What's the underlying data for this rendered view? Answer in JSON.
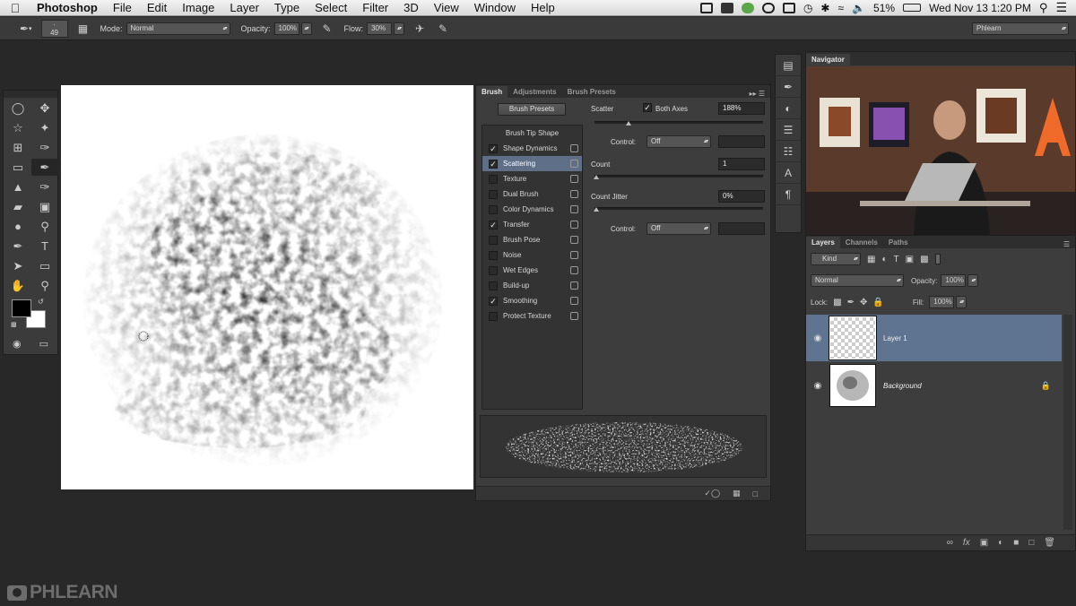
{
  "menubar": {
    "app_name": "Photoshop",
    "items": [
      "File",
      "Edit",
      "Image",
      "Layer",
      "Type",
      "Select",
      "Filter",
      "3D",
      "View",
      "Window",
      "Help"
    ],
    "battery": "51%",
    "datetime": "Wed Nov 13  1:20 PM"
  },
  "options": {
    "brush_size": "49",
    "mode_label": "Mode:",
    "mode_value": "Normal",
    "opacity_label": "Opacity:",
    "opacity_value": "100%",
    "flow_label": "Flow:",
    "flow_value": "30%",
    "workspace": "Phlearn"
  },
  "brush_panel": {
    "tabs": [
      "Brush",
      "Adjustments",
      "Brush Presets"
    ],
    "presets_button": "Brush Presets",
    "list_header": "Brush Tip Shape",
    "items": [
      {
        "label": "Shape Dynamics",
        "checked": true
      },
      {
        "label": "Scattering",
        "checked": true,
        "selected": true
      },
      {
        "label": "Texture",
        "checked": false
      },
      {
        "label": "Dual Brush",
        "checked": false
      },
      {
        "label": "Color Dynamics",
        "checked": false
      },
      {
        "label": "Transfer",
        "checked": true
      },
      {
        "label": "Brush Pose",
        "checked": false
      },
      {
        "label": "Noise",
        "checked": false
      },
      {
        "label": "Wet Edges",
        "checked": false
      },
      {
        "label": "Build-up",
        "checked": false
      },
      {
        "label": "Smoothing",
        "checked": true
      },
      {
        "label": "Protect Texture",
        "checked": false
      }
    ],
    "scatter_label": "Scatter",
    "both_axes_label": "Both Axes",
    "scatter_value": "188%",
    "control_label": "Control:",
    "control_value": "Off",
    "count_label": "Count",
    "count_value": "1",
    "count_jitter_label": "Count Jitter",
    "count_jitter_value": "0%",
    "control2_label": "Control:",
    "control2_value": "Off"
  },
  "navigator": {
    "title": "Navigator"
  },
  "layers_panel": {
    "tabs": [
      "Layers",
      "Channels",
      "Paths"
    ],
    "kind_label": "Kind",
    "blend_mode": "Normal",
    "opacity_label": "Opacity:",
    "opacity_value": "100%",
    "lock_label": "Lock:",
    "fill_label": "Fill:",
    "fill_value": "100%",
    "layers": [
      {
        "name": "Layer 1",
        "selected": true
      },
      {
        "name": "Background",
        "selected": false
      }
    ]
  },
  "watermark": "PHLEARN",
  "colors": {
    "panel_bg": "#3d3d3d",
    "selection": "#5f7490",
    "app_bg": "#282828"
  }
}
